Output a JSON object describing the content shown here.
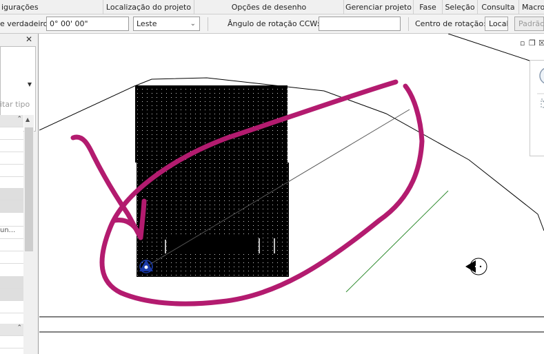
{
  "ribbon": {
    "tabs": [
      {
        "label": "igurações"
      },
      {
        "label": "Localização do projeto"
      },
      {
        "label": "Opções de desenho"
      },
      {
        "label": "Gerenciar projeto"
      },
      {
        "label": "Fase"
      },
      {
        "label": "Seleção"
      },
      {
        "label": "Consulta"
      },
      {
        "label": "Macro"
      }
    ]
  },
  "options_bar": {
    "true_north_label": "e verdadeiro:",
    "true_north_value": "0° 00' 00\"",
    "direction_value": "Leste",
    "rotation_label": "Ângulo de rotação CCW:",
    "rotation_value": "",
    "center_label": "Centro de rotação:",
    "local_button": "Local",
    "default_button": "Padrão"
  },
  "properties_panel": {
    "close_glyph": "✕",
    "edit_type_label": "itar tipo",
    "collapse_glyph": "⌃",
    "truncated_row": "un..."
  },
  "colors": {
    "annotation": "#b31b6f",
    "survey_point": "#1a3aa8",
    "green_line": "#2e8b2e"
  }
}
